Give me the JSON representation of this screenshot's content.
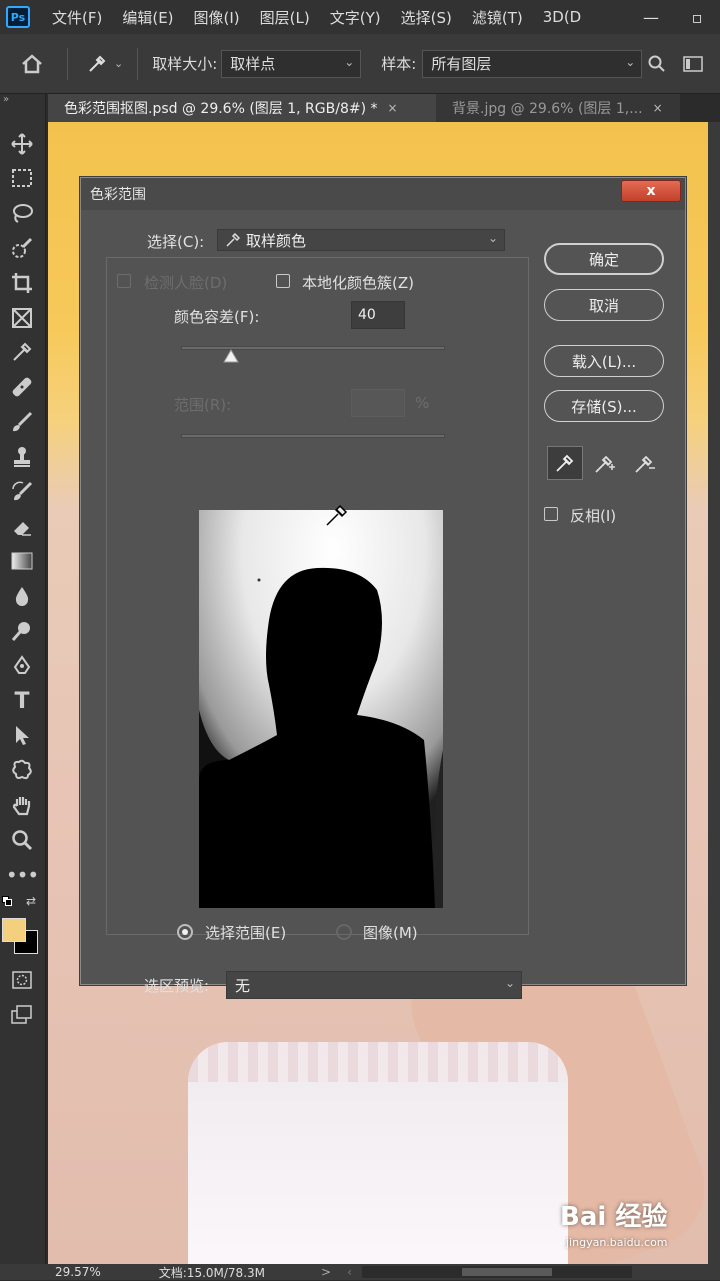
{
  "menubar": {
    "logo": "Ps",
    "items": [
      "文件(F)",
      "编辑(E)",
      "图像(I)",
      "图层(L)",
      "文字(Y)",
      "选择(S)",
      "滤镜(T)",
      "3D(D"
    ],
    "win_minimize": "—",
    "win_restore": "▫"
  },
  "optionsbar": {
    "sample_size_label": "取样大小:",
    "sample_size_value": "取样点",
    "sample_label": "样本:",
    "sample_value": "所有图层"
  },
  "tabs": [
    {
      "label": "色彩范围抠图.psd @ 29.6% (图层 1, RGB/8#) *",
      "close": "×"
    },
    {
      "label": "背景.jpg @ 29.6% (图层 1,...",
      "close": "×"
    }
  ],
  "dialog": {
    "title": "色彩范围",
    "close": "x",
    "select_label": "选择(C):",
    "select_value": "取样颜色",
    "detect_faces": "检测人脸(D)",
    "localized_clusters": "本地化颜色簇(Z)",
    "fuzziness_label": "颜色容差(F):",
    "fuzziness_value": "40",
    "fuzziness_fraction": 0.19,
    "range_label": "范围(R):",
    "range_unit": "%",
    "ok": "确定",
    "cancel": "取消",
    "load": "载入(L)...",
    "save": "存储(S)...",
    "invert": "反相(I)",
    "view_selection": "选择范围(E)",
    "view_image": "图像(M)",
    "preview_label": "选区预览:",
    "preview_value": "无"
  },
  "statusbar": {
    "zoom": "29.57%",
    "doc_info": "文档:15.0M/78.3M",
    "arrow": ">"
  },
  "watermark": {
    "brand": "Bai 经验",
    "url": "jingyan.baidu.com"
  }
}
